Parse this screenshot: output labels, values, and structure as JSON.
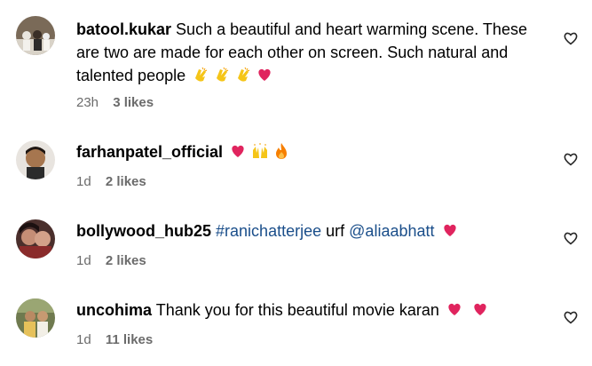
{
  "comments": [
    {
      "username": "batool.kukar",
      "text": "Such a beautiful and heart warming scene. These are two are made for each other on screen. Such natural and talented people",
      "emojis": [
        "clapping-hands-icon",
        "clapping-hands-icon",
        "clapping-hands-icon",
        "red-heart-icon"
      ],
      "time": "23h",
      "likes": "3 likes"
    },
    {
      "username": "farhanpatel_official",
      "text": "",
      "emojis": [
        "red-heart-icon",
        "raising-hands-icon",
        "fire-icon"
      ],
      "time": "1d",
      "likes": "2 likes"
    },
    {
      "username": "bollywood_hub25",
      "hashtag": "#ranichatterjee",
      "middle": "urf",
      "mention": "@aliaabhatt",
      "emojis": [
        "red-heart-icon"
      ],
      "time": "1d",
      "likes": "2 likes"
    },
    {
      "username": "uncohima",
      "text": "Thank you for this beautiful movie karan",
      "emojis": [
        "red-heart-icon",
        "red-heart-icon"
      ],
      "time": "1d",
      "likes": "11 likes"
    }
  ],
  "colors": {
    "link": "#1a4e8a",
    "meta": "#6b6b6b",
    "heart": "#e0245e"
  }
}
